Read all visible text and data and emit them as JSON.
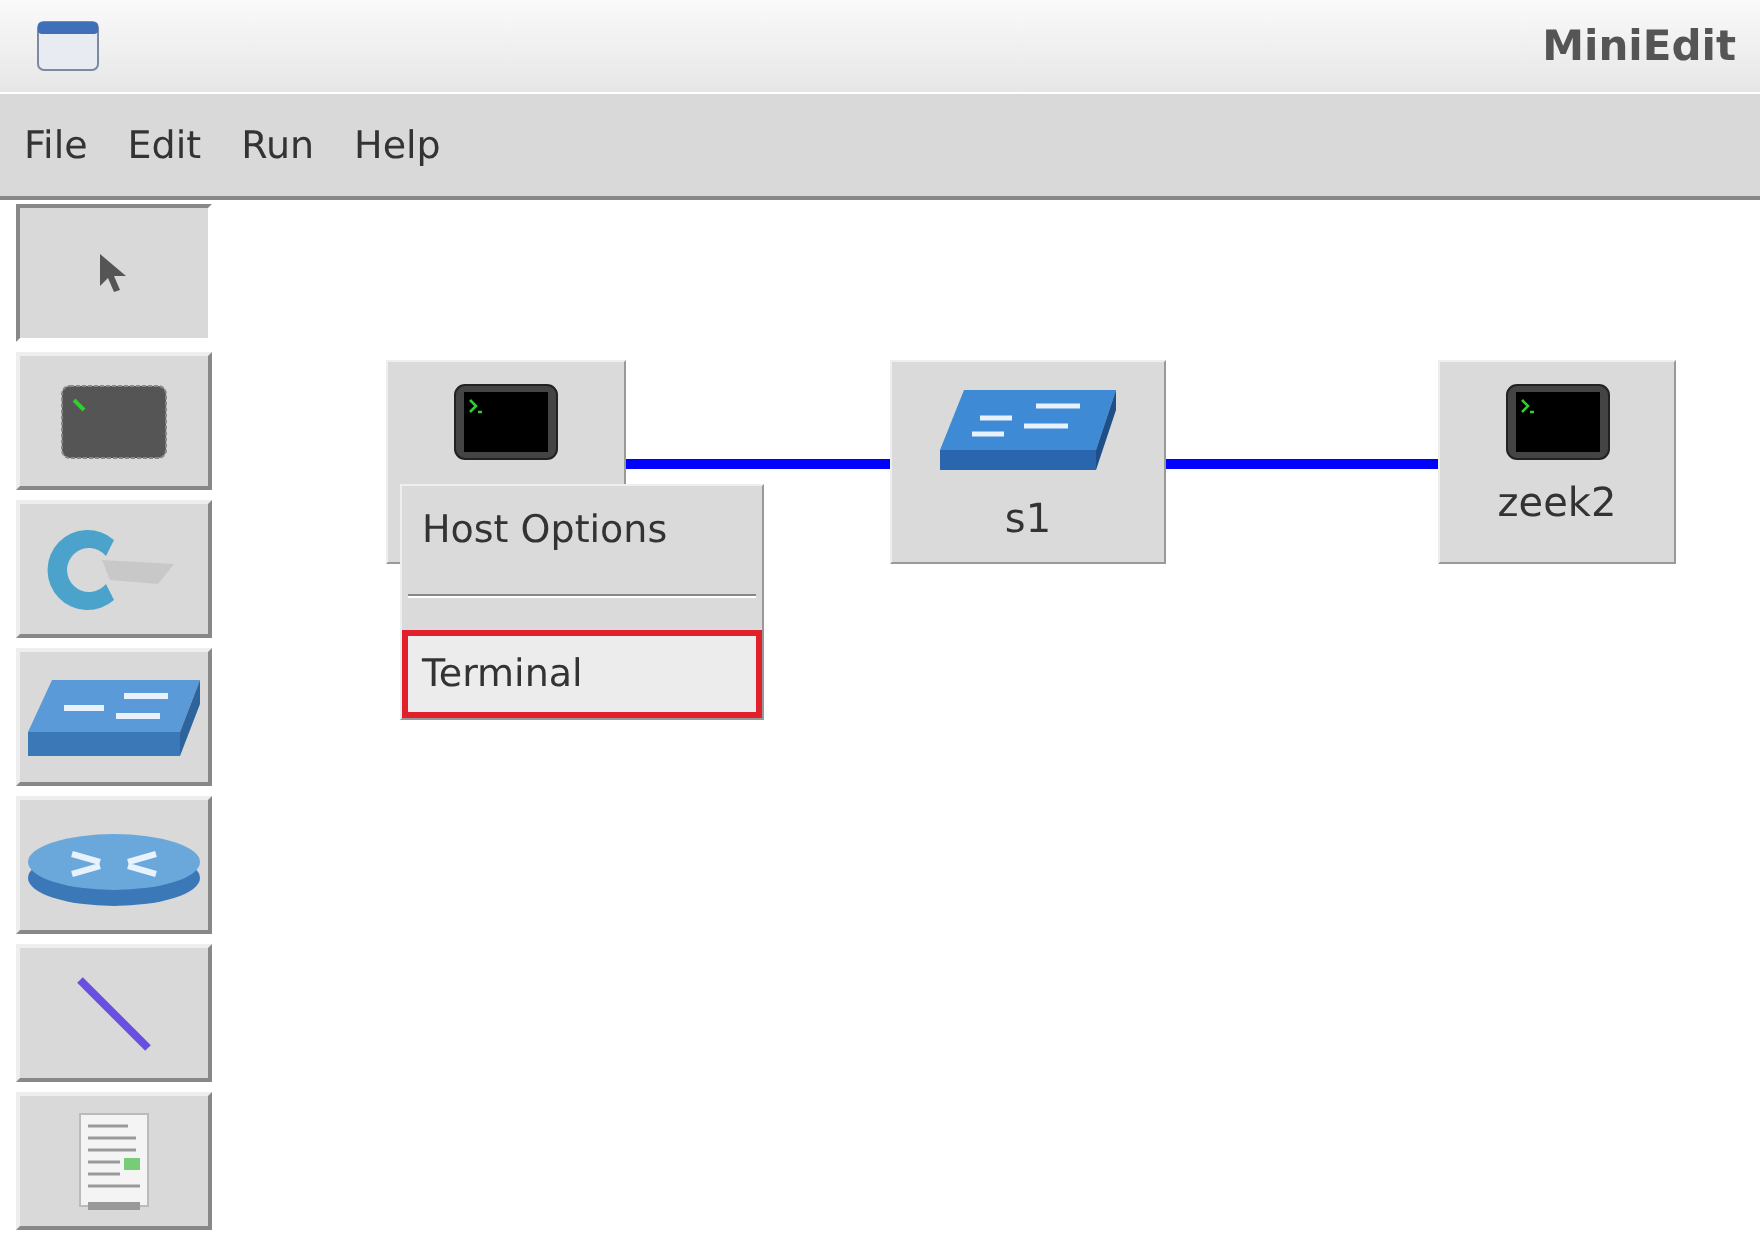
{
  "window": {
    "title": "MiniEdit"
  },
  "menu_bar": [
    {
      "label": "File"
    },
    {
      "label": "Edit"
    },
    {
      "label": "Run"
    },
    {
      "label": "Help"
    }
  ],
  "toolbar": [
    {
      "kind": "select",
      "selected": true
    },
    {
      "kind": "host",
      "selected": false
    },
    {
      "kind": "controller",
      "selected": false
    },
    {
      "kind": "switch",
      "selected": false
    },
    {
      "kind": "router",
      "selected": false
    },
    {
      "kind": "link",
      "selected": false
    },
    {
      "kind": "netflow",
      "selected": false
    }
  ],
  "canvas": {
    "nodes": [
      {
        "kind": "host"
      },
      {
        "kind": "switch",
        "label": "s1"
      },
      {
        "kind": "host",
        "label": "zeek2"
      }
    ]
  },
  "context_menu": {
    "items": [
      {
        "kind": "item",
        "label": "Host Options",
        "selected": false
      },
      {
        "kind": "separator"
      },
      {
        "kind": "item",
        "label": "Terminal",
        "selected": true
      }
    ]
  }
}
